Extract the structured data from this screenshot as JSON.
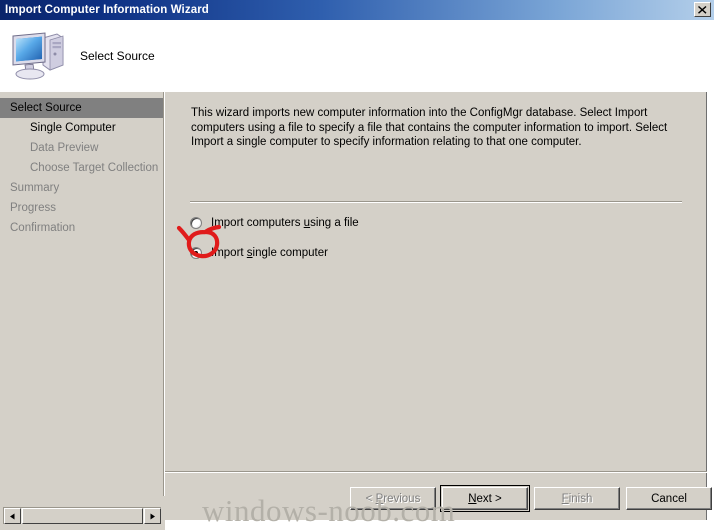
{
  "window": {
    "title": "Import Computer Information Wizard",
    "close_icon": "close-icon"
  },
  "header": {
    "icon": "computer-icon",
    "title": "Select Source"
  },
  "sidebar": {
    "items": [
      {
        "label": "Select Source",
        "state": "active"
      },
      {
        "label": "Single Computer",
        "state": "strong"
      },
      {
        "label": "Data Preview",
        "state": "disabled"
      },
      {
        "label": "Choose Target Collection",
        "state": "disabled"
      },
      {
        "label": "Summary",
        "state": "disabled"
      },
      {
        "label": "Progress",
        "state": "disabled"
      },
      {
        "label": "Confirmation",
        "state": "disabled"
      }
    ]
  },
  "content": {
    "intro": "This wizard imports new computer information into the ConfigMgr database. Select Import computers using a file to specify a file that contains the computer information to import. Select Import a single computer to specify information relating to that one computer.",
    "options": [
      {
        "label_pre": "Import computers ",
        "label_accel": "u",
        "label_post": "sing a file",
        "checked": false
      },
      {
        "label_pre": "Import ",
        "label_accel": "s",
        "label_post": "ingle computer",
        "checked": true
      }
    ],
    "annotation": {
      "shape": "red-circle-highlight",
      "color": "#e01b1b",
      "target": "import-single-computer-radio"
    }
  },
  "buttons": {
    "previous": {
      "label_pre": "< ",
      "label_accel": "P",
      "label_post": "revious",
      "disabled": true
    },
    "next": {
      "label_pre": "",
      "label_accel": "N",
      "label_post": "ext >",
      "disabled": false,
      "default": true
    },
    "finish": {
      "label_pre": "",
      "label_accel": "F",
      "label_post": "inish",
      "disabled": true
    },
    "cancel": {
      "label_pre": "",
      "label_accel": "",
      "label_post": "Cancel",
      "disabled": false
    }
  },
  "scrollbar": {
    "left_arrow_icon": "triangle-left-icon",
    "right_arrow_icon": "triangle-right-icon"
  },
  "watermark": {
    "text": "windows-noob.com"
  },
  "colors": {
    "title_start": "#0a246a",
    "title_end": "#b4cfea",
    "dialog_face": "#d4d0c8",
    "nav_active_bg": "#808080",
    "disabled_text": "#808080",
    "annotation_red": "#e01b1b"
  }
}
